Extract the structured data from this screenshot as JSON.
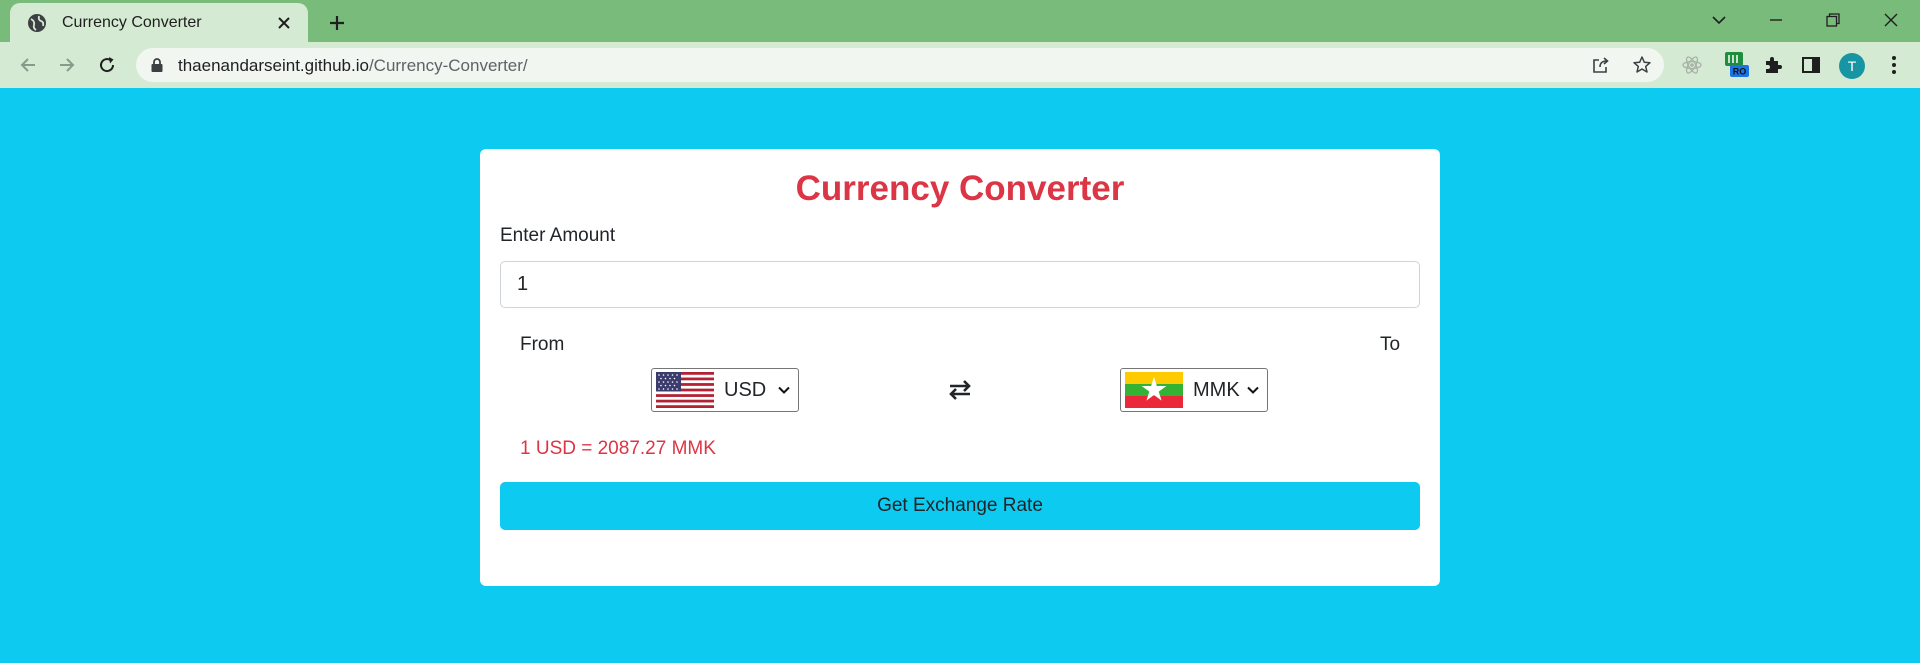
{
  "browser": {
    "tab": {
      "title": "Currency Converter"
    },
    "address": {
      "domain": "thaenandarseint.github.io",
      "path": "/Currency-Converter/"
    },
    "extensions": [
      {
        "name": "react-devtools-icon"
      },
      {
        "name": "ro-extension-icon",
        "badge": "RO"
      },
      {
        "name": "puzzle-icon"
      },
      {
        "name": "sidepanel-icon"
      }
    ],
    "profile": {
      "initial": "T"
    }
  },
  "converter": {
    "title": "Currency Converter",
    "amount_label": "Enter Amount",
    "amount_value": "1",
    "from_label": "From",
    "to_label": "To",
    "from_currency": "USD",
    "to_currency": "MMK",
    "rate_text": "1 USD = 2087.27 MMK",
    "button_label": "Get Exchange Rate"
  },
  "colors": {
    "page_bg": "#0dcaf0",
    "title": "#dc3545",
    "rate_text": "#dc3545",
    "button_bg": "#0dcaf0",
    "tabbar": "#78bb7b"
  }
}
